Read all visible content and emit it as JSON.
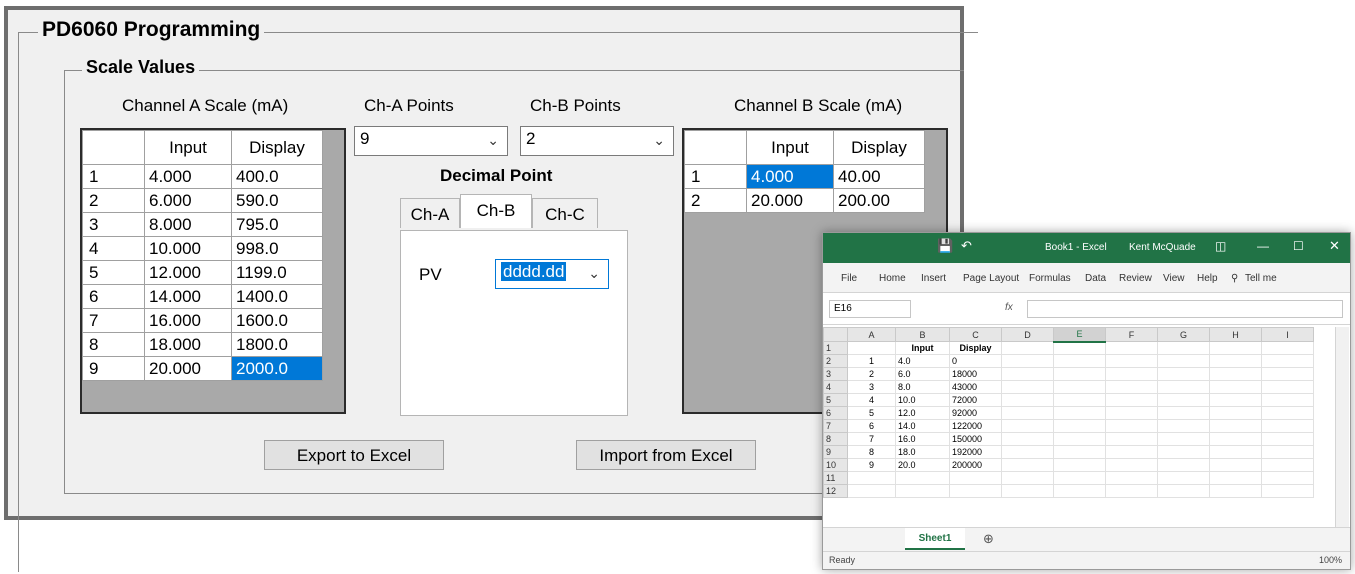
{
  "app": {
    "title": "PD6060 Programming",
    "group": "Scale Values",
    "channel_a_label": "Channel A Scale (mA)",
    "channel_b_label": "Channel B Scale (mA)",
    "cha_points_label": "Ch-A Points",
    "chb_points_label": "Ch-B Points",
    "cha_points_value": "9",
    "chb_points_value": "2",
    "decimal_point_label": "Decimal Point",
    "tabs": [
      "Ch-A",
      "Ch-B",
      "Ch-C"
    ],
    "active_tab": "Ch-B",
    "pv_label": "PV",
    "pv_value": "dddd.dd",
    "export_label": "Export to Excel",
    "import_label": "Import from Excel",
    "grid_headers": [
      "Input",
      "Display"
    ],
    "grid_a": [
      [
        "1",
        "4.000",
        "400.0"
      ],
      [
        "2",
        "6.000",
        "590.0"
      ],
      [
        "3",
        "8.000",
        "795.0"
      ],
      [
        "4",
        "10.000",
        "998.0"
      ],
      [
        "5",
        "12.000",
        "1199.0"
      ],
      [
        "6",
        "14.000",
        "1400.0"
      ],
      [
        "7",
        "16.000",
        "1600.0"
      ],
      [
        "8",
        "18.000",
        "1800.0"
      ],
      [
        "9",
        "20.000",
        "2000.0"
      ]
    ],
    "grid_b": [
      [
        "1",
        "4.000",
        "40.00"
      ],
      [
        "2",
        "20.000",
        "200.00"
      ]
    ],
    "colors": {
      "selection": "#0078d7",
      "excel_green": "#217346"
    }
  },
  "excel": {
    "window_title": "Book1 - Excel",
    "user": "Kent McQuade",
    "ribbon": [
      "File",
      "Home",
      "Insert",
      "Page Layout",
      "Formulas",
      "Data",
      "Review",
      "View",
      "Help",
      "Tell me"
    ],
    "name_box": "E16",
    "fx": "fx",
    "columns": [
      "A",
      "B",
      "C",
      "D",
      "E",
      "F",
      "G",
      "H",
      "I"
    ],
    "header_row": [
      "",
      "Input",
      "Display"
    ],
    "rows": [
      [
        "1",
        "4.0",
        "0"
      ],
      [
        "2",
        "6.0",
        "18000"
      ],
      [
        "3",
        "8.0",
        "43000"
      ],
      [
        "4",
        "10.0",
        "72000"
      ],
      [
        "5",
        "12.0",
        "92000"
      ],
      [
        "6",
        "14.0",
        "122000"
      ],
      [
        "7",
        "16.0",
        "150000"
      ],
      [
        "8",
        "18.0",
        "192000"
      ],
      [
        "9",
        "20.0",
        "200000"
      ]
    ],
    "row_numbers": [
      "1",
      "2",
      "3",
      "4",
      "5",
      "6",
      "7",
      "8",
      "9",
      "10",
      "11",
      "12"
    ],
    "sheet_tab": "Sheet1",
    "status": "Ready",
    "zoom": "100%"
  }
}
